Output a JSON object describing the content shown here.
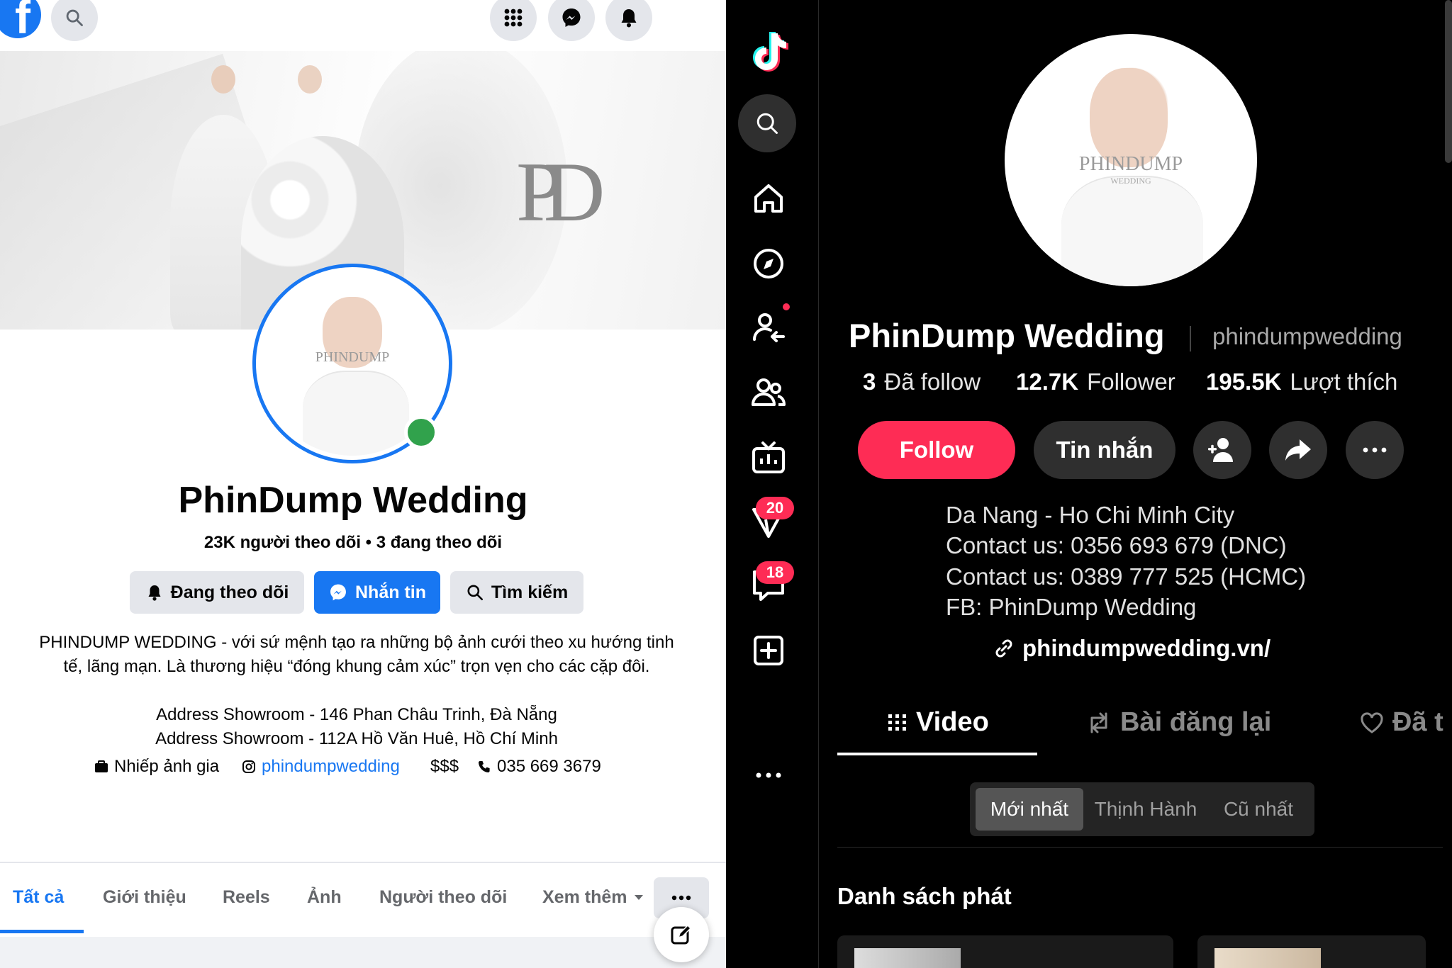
{
  "facebook": {
    "page_name": "PhinDump Wedding",
    "stats": "23K người theo dõi • 3 đang theo dõi",
    "cover_monogram": "PD",
    "avatar_watermark": "PHINDUMP",
    "buttons": {
      "following": "Đang theo dõi",
      "message": "Nhắn tin",
      "search": "Tìm kiếm"
    },
    "bio_line1": "PHINDUMP WEDDING - với sứ mệnh tạo ra những bộ ảnh cưới theo xu hướng tinh",
    "bio_line2": "tế, lãng mạn. Là thương hiệu “đóng khung cảm xúc” trọn vẹn cho các cặp đôi.",
    "address1": "Address Showroom - 146 Phan Châu Trinh, Đà Nẵng",
    "address2": "Address Showroom - 112A Hồ Văn Huê, Hồ Chí Minh",
    "info": {
      "category": "Nhiếp ảnh gia",
      "instagram": "phindumpwedding",
      "price": "$$$",
      "phone": "035 669 3679"
    },
    "tabs": [
      "Tất cả",
      "Giới thiệu",
      "Reels",
      "Ảnh",
      "Người theo dõi",
      "Xem thêm"
    ],
    "active_tab": "Tất cả",
    "colors": {
      "brand_blue": "#1877f2",
      "button_gray": "#e4e6eb",
      "online_green": "#31a24c"
    }
  },
  "tiktok": {
    "display_name": "PhinDump Wedding",
    "username": "phindumpwedding",
    "avatar_watermark": "PHINDUMP",
    "avatar_watermark_sub": "WEDDING",
    "stats": {
      "following_count": "3",
      "following_label": "Đã follow",
      "followers_count": "12.7K",
      "followers_label": "Follower",
      "likes_count": "195.5K",
      "likes_label": "Lượt thích"
    },
    "buttons": {
      "follow": "Follow",
      "message": "Tin nhắn"
    },
    "bio": [
      "Da Nang - Ho Chi Minh City",
      "Contact us: 0356 693 679 (DNC)",
      "Contact us: 0389 777 525 (HCMC)",
      "FB: PhinDump Wedding"
    ],
    "link": "phindumpwedding.vn/",
    "tabs": {
      "video": "Video",
      "reposts": "Bài đăng lại",
      "liked": "Đã t"
    },
    "sort": {
      "latest": "Mới nhất",
      "popular": "Thịnh Hành",
      "oldest": "Cũ nhất"
    },
    "playlist_heading": "Danh sách phát",
    "badges": {
      "inbox": "20",
      "messages": "18"
    },
    "colors": {
      "accent": "#fe2c55",
      "background": "#000000",
      "button_dark": "#2f2f2f"
    }
  }
}
